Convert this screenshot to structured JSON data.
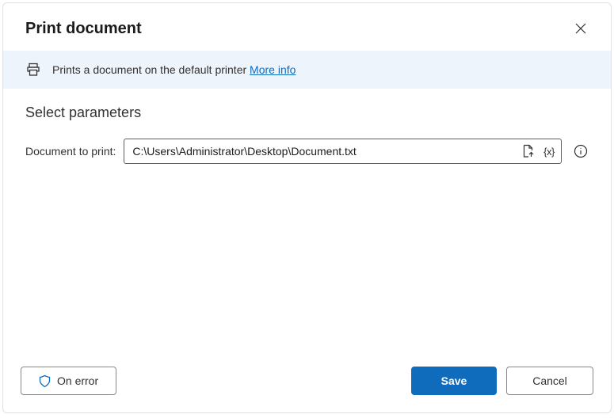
{
  "header": {
    "title": "Print document"
  },
  "infobar": {
    "text": "Prints a document on the default printer ",
    "link": "More info"
  },
  "parameters": {
    "section_title": "Select parameters",
    "doc_label": "Document to print:",
    "doc_value": "C:\\Users\\Administrator\\Desktop\\Document.txt"
  },
  "footer": {
    "on_error": "On error",
    "save": "Save",
    "cancel": "Cancel"
  }
}
